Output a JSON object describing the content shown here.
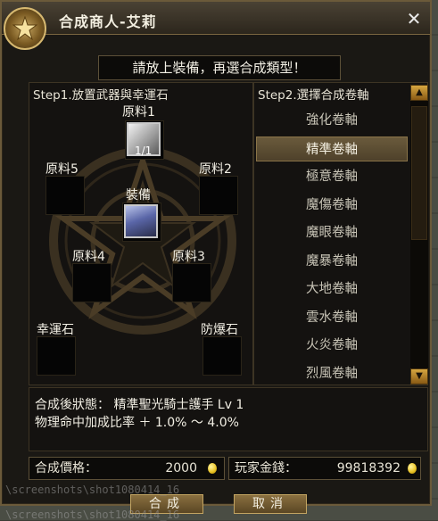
{
  "window": {
    "title": "合成商人-艾莉",
    "close_label": "✕"
  },
  "instruction": "請放上裝備，再選合成類型！",
  "left_panel": {
    "step_label": "Step1.放置武器與幸運石",
    "slots": {
      "material1": {
        "label": "原料1",
        "count": "1/1"
      },
      "material2": {
        "label": "原料2"
      },
      "material3": {
        "label": "原料3"
      },
      "material4": {
        "label": "原料4"
      },
      "material5": {
        "label": "原料5"
      },
      "equipment": {
        "label": "裝備"
      },
      "luck_stone": {
        "label": "幸運石"
      },
      "protect_stone": {
        "label": "防爆石"
      }
    }
  },
  "right_panel": {
    "step_label": "Step2.選擇合成卷軸",
    "scrolls": [
      {
        "label": "強化卷軸",
        "selected": false
      },
      {
        "label": "精準卷軸",
        "selected": true
      },
      {
        "label": "極意卷軸",
        "selected": false
      },
      {
        "label": "魔傷卷軸",
        "selected": false
      },
      {
        "label": "魔眼卷軸",
        "selected": false
      },
      {
        "label": "魔暴卷軸",
        "selected": false
      },
      {
        "label": "大地卷軸",
        "selected": false
      },
      {
        "label": "雲水卷軸",
        "selected": false
      },
      {
        "label": "火炎卷軸",
        "selected": false
      },
      {
        "label": "烈風卷軸",
        "selected": false
      }
    ]
  },
  "result": {
    "line1": "合成後狀態： 精準聖光騎士護手 Lv 1",
    "line2": "物理命中加成比率 ＋ 1.0% ～ 4.0%"
  },
  "price": {
    "label": "合成價格：",
    "value": "2000"
  },
  "player_money": {
    "label": "玩家金錢：",
    "value": "99818392"
  },
  "buttons": {
    "compose": "合成",
    "cancel": "取消"
  },
  "watermark": "\\screenshots\\shot1080414_16",
  "colors": {
    "accent_gold": "#c2a462",
    "selected_row": "#6a5a3c",
    "background": "#141210"
  }
}
